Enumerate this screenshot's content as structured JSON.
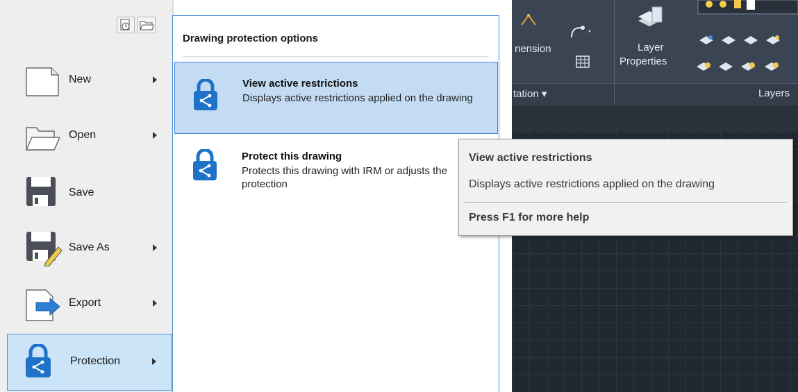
{
  "app_menu": {
    "items": [
      {
        "label": "New",
        "icon": "new-document-icon"
      },
      {
        "label": "Open",
        "icon": "open-folder-icon"
      },
      {
        "label": "Save",
        "icon": "save-disk-icon"
      },
      {
        "label": "Save As",
        "icon": "save-as-icon"
      },
      {
        "label": "Export",
        "icon": "export-icon"
      },
      {
        "label": "Protection",
        "icon": "protection-lock-icon"
      }
    ],
    "active_item": "Protection",
    "quick_icons": [
      "recent-documents-icon",
      "open-documents-icon"
    ]
  },
  "submenu": {
    "title": "Drawing protection options",
    "options": [
      {
        "title": "View active restrictions",
        "description": "Displays active restrictions applied on the drawing"
      },
      {
        "title": "Protect this drawing",
        "description": "Protects this drawing with IRM or adjusts the protection"
      }
    ]
  },
  "tooltip": {
    "title": "View active restrictions",
    "description": "Displays active restrictions applied on the drawing",
    "help": "Press F1 for more help"
  },
  "ribbon": {
    "dimension_label": "nension",
    "annotation_panel": "tation",
    "layer_properties_line1": "Layer",
    "layer_properties_line2": "Properties",
    "layers_panel": "Layers"
  },
  "colors": {
    "accent_blue": "#1e73c8",
    "highlight_bg": "#c4dcf3",
    "ribbon_dark": "#3b4453",
    "canvas_dark": "#212832"
  }
}
